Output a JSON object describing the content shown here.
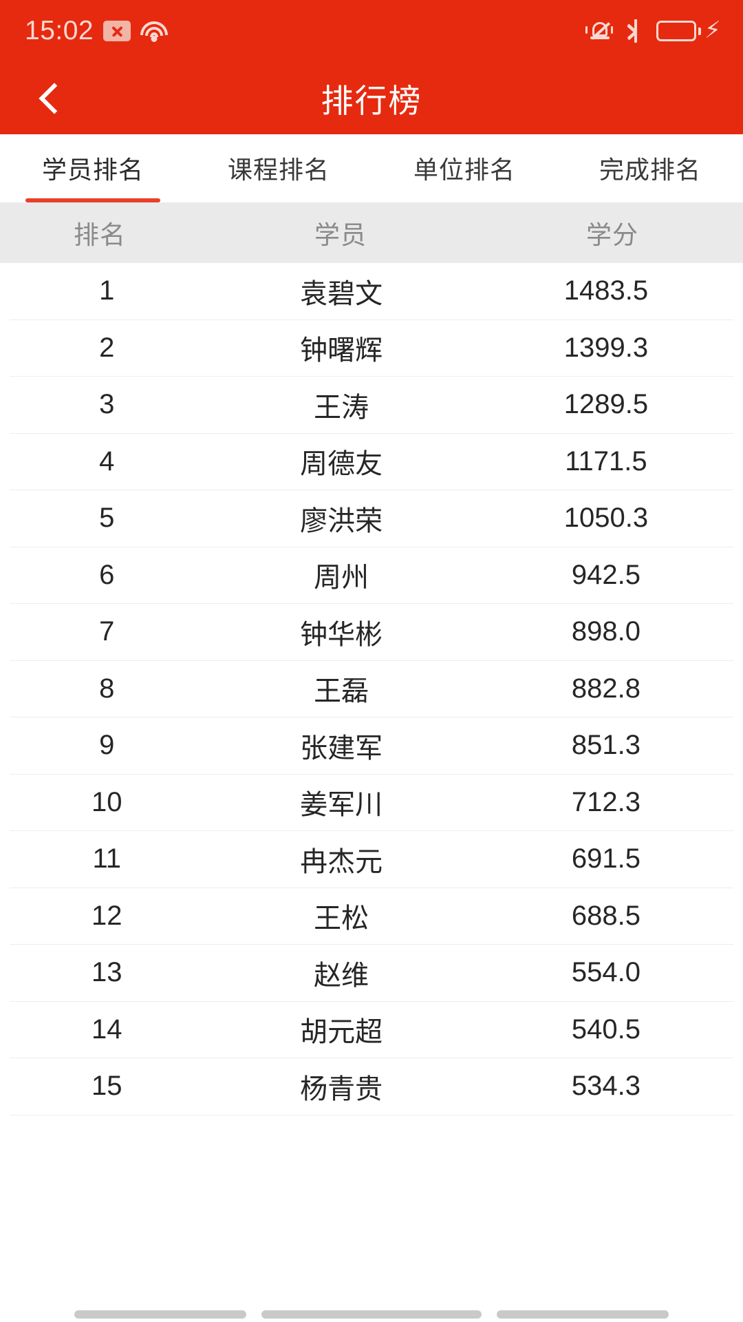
{
  "status_bar": {
    "time": "15:02",
    "icons": [
      "sms-blocked-icon",
      "wifi-icon",
      "silent-bell-icon",
      "bluetooth-icon",
      "battery-charging-icon"
    ],
    "accent": "#E62A10",
    "icon_color": "#FBD9D3"
  },
  "app_bar": {
    "title": "排行榜",
    "back_icon": "chevron-left-icon",
    "background": "#E62A10",
    "title_color": "#FFFFFF"
  },
  "tabs": {
    "active_index": 0,
    "indicator_color": "#E8412B",
    "items": [
      {
        "label": "学员排名"
      },
      {
        "label": "课程排名"
      },
      {
        "label": "单位排名"
      },
      {
        "label": "完成排名"
      }
    ]
  },
  "table": {
    "header_background": "#EAEAEA",
    "columns": [
      {
        "key": "rank",
        "label": "排名"
      },
      {
        "key": "name",
        "label": "学员"
      },
      {
        "key": "score",
        "label": "学分"
      }
    ],
    "rows": [
      {
        "rank": "1",
        "name": "袁碧文",
        "score": "1483.5"
      },
      {
        "rank": "2",
        "name": "钟曙辉",
        "score": "1399.3"
      },
      {
        "rank": "3",
        "name": "王涛",
        "score": "1289.5"
      },
      {
        "rank": "4",
        "name": "周德友",
        "score": "1171.5"
      },
      {
        "rank": "5",
        "name": "廖洪荣",
        "score": "1050.3"
      },
      {
        "rank": "6",
        "name": "周州",
        "score": "942.5"
      },
      {
        "rank": "7",
        "name": "钟华彬",
        "score": "898.0"
      },
      {
        "rank": "8",
        "name": "王磊",
        "score": "882.8"
      },
      {
        "rank": "9",
        "name": "张建军",
        "score": "851.3"
      },
      {
        "rank": "10",
        "name": "姜军川",
        "score": "712.3"
      },
      {
        "rank": "11",
        "name": "冉杰元",
        "score": "691.5"
      },
      {
        "rank": "12",
        "name": "王松",
        "score": "688.5"
      },
      {
        "rank": "13",
        "name": "赵维",
        "score": "554.0"
      },
      {
        "rank": "14",
        "name": "胡元超",
        "score": "540.5"
      },
      {
        "rank": "15",
        "name": "杨青贵",
        "score": "534.3"
      }
    ]
  }
}
